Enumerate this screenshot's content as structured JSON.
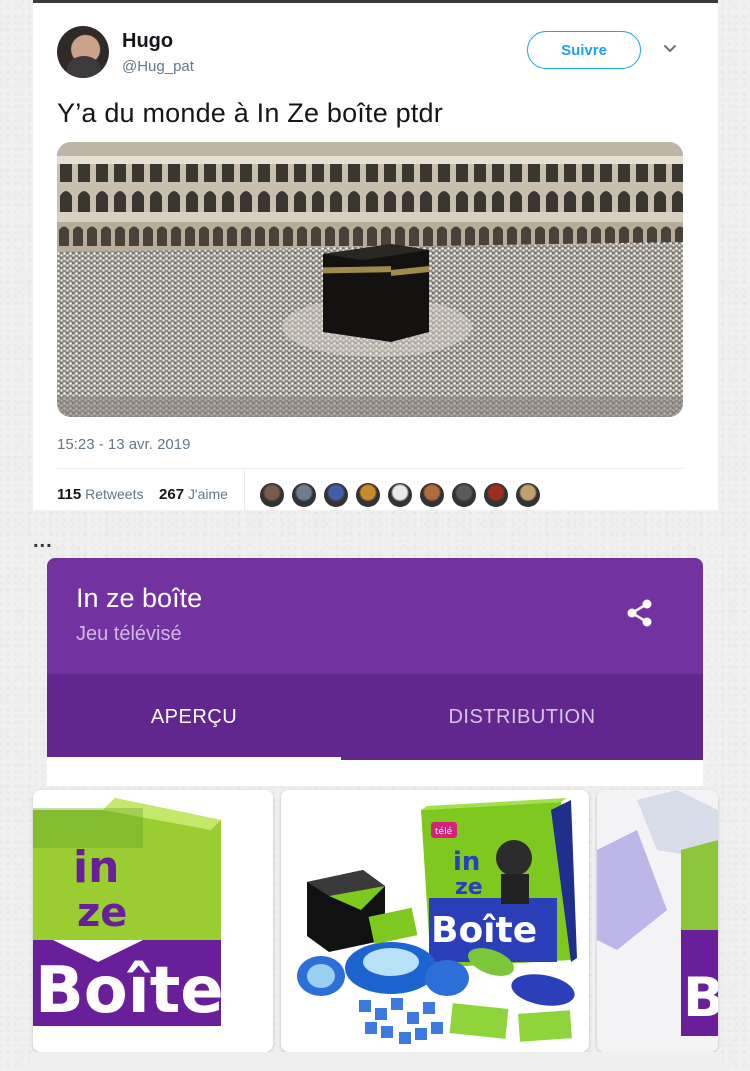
{
  "tweet": {
    "user_name": "Hugo",
    "handle": "@Hug_pat",
    "follow_label": "Suivre",
    "text": "Y’a du monde à In Ze boîte ptdr",
    "timestamp": "15:23 - 13 avr. 2019",
    "retweets_count": "115",
    "retweets_label": "Retweets",
    "likes_count": "267",
    "likes_label": "J'aime",
    "liker_avatars": [
      "#7a5a48",
      "#6f7d8c",
      "#3f5fa8",
      "#c98a2c",
      "#e8e8e8",
      "#b06a3c",
      "#5a5a5a",
      "#9c2e20",
      "#c4a070"
    ]
  },
  "separator": "...",
  "panel": {
    "title": "In ze boîte",
    "subtitle": "Jeu télévisé",
    "tabs": [
      "APERÇU",
      "DISTRIBUTION"
    ],
    "active_tab": "APERÇU",
    "header_color": "#7232a0",
    "tabs_color": "#62278f"
  },
  "carousel": {
    "images": [
      {
        "logo_lines": [
          "in",
          "ze",
          "Boîte"
        ]
      },
      {
        "logo_lines": [
          "in",
          "ze",
          "Boîte"
        ],
        "sticker": "télé"
      },
      {
        "logo_lines": [
          "B"
        ]
      }
    ]
  }
}
